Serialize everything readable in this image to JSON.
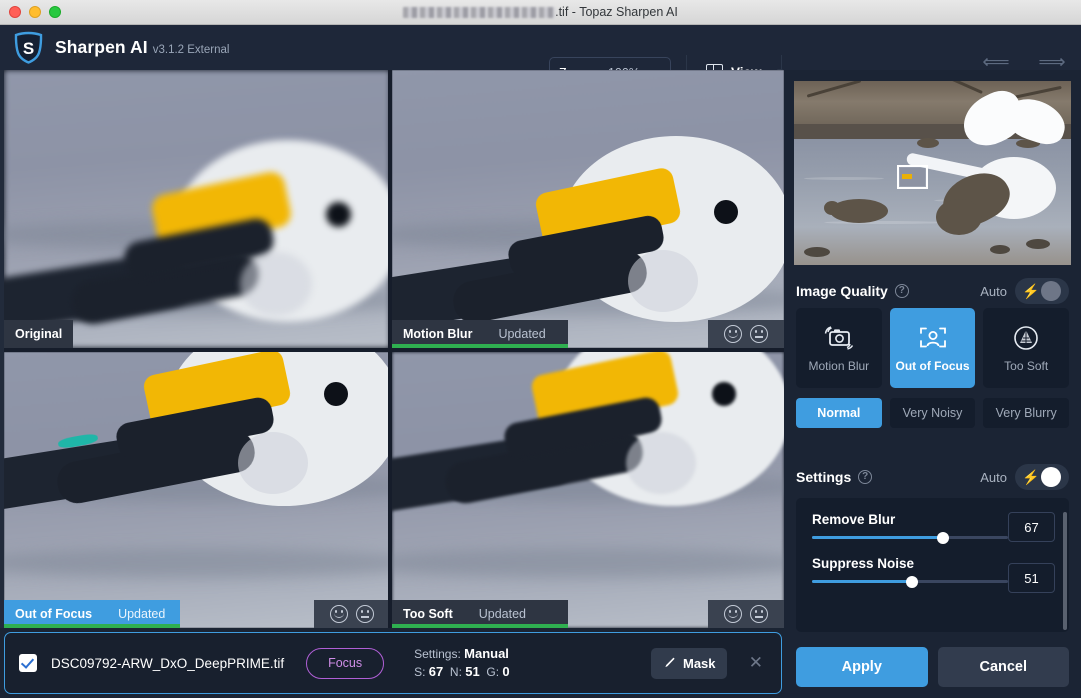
{
  "window": {
    "title_suffix": ".tif - Topaz Sharpen AI",
    "title_redacted": true,
    "traffic_lights": [
      "close-button",
      "minimize-button",
      "zoom-button"
    ]
  },
  "header": {
    "brand": "Sharpen AI",
    "version": "v3.1.2 External",
    "logo_letter": "S",
    "zoom": {
      "label": "Zoom",
      "value": "100%"
    },
    "view": {
      "label": "View"
    },
    "undo": {
      "label": "Undo"
    },
    "redo": {
      "label": "Redo"
    }
  },
  "previews": [
    {
      "name": "Original",
      "status": "",
      "selected": false,
      "updated_bar": false,
      "faces": false
    },
    {
      "name": "Motion Blur",
      "status": "Updated",
      "selected": false,
      "updated_bar": true,
      "faces": true
    },
    {
      "name": "Out of Focus",
      "status": "Updated",
      "selected": true,
      "updated_bar": true,
      "faces": true
    },
    {
      "name": "Too Soft",
      "status": "Updated",
      "selected": false,
      "updated_bar": true,
      "faces": true
    }
  ],
  "face_icons": {
    "happy": "happy-face-icon",
    "neutral": "neutral-face-icon"
  },
  "navigator": {
    "name": "navigator-preview",
    "selection_visible": true
  },
  "image_quality": {
    "title": "Image Quality",
    "auto_label": "Auto",
    "auto_on": false,
    "modes": [
      {
        "label": "Motion Blur",
        "icon": "camera-shake-icon",
        "active": false
      },
      {
        "label": "Out of Focus",
        "icon": "focus-person-icon",
        "active": true
      },
      {
        "label": "Too Soft",
        "icon": "cone-circle-icon",
        "active": false
      }
    ],
    "quality_levels": [
      {
        "label": "Normal",
        "active": true
      },
      {
        "label": "Very Noisy",
        "active": false
      },
      {
        "label": "Very Blurry",
        "active": false
      }
    ]
  },
  "settings": {
    "title": "Settings",
    "auto_label": "Auto",
    "auto_on": false,
    "sliders": [
      {
        "label": "Remove Blur",
        "value": "67",
        "percent": 67
      },
      {
        "label": "Suppress Noise",
        "value": "51",
        "percent": 51
      }
    ]
  },
  "actions": {
    "apply": "Apply",
    "cancel": "Cancel"
  },
  "filebar": {
    "checked": true,
    "filename": "DSC09792-ARW_DxO_DeepPRIME.tif",
    "focus_button": "Focus",
    "settings_prefix": "Settings:",
    "settings_mode": "Manual",
    "s_label": "S:",
    "s_value": "67",
    "n_label": "N:",
    "n_value": "51",
    "g_label": "G:",
    "g_value": "0",
    "mask_button": "Mask",
    "close_label": "✕"
  },
  "colors": {
    "accent_blue": "#3f9de0",
    "panel_bg": "#1b2434",
    "card_bg": "#141d2c",
    "updated_green": "#2faf50",
    "focus_purple": "#b05fd6"
  }
}
